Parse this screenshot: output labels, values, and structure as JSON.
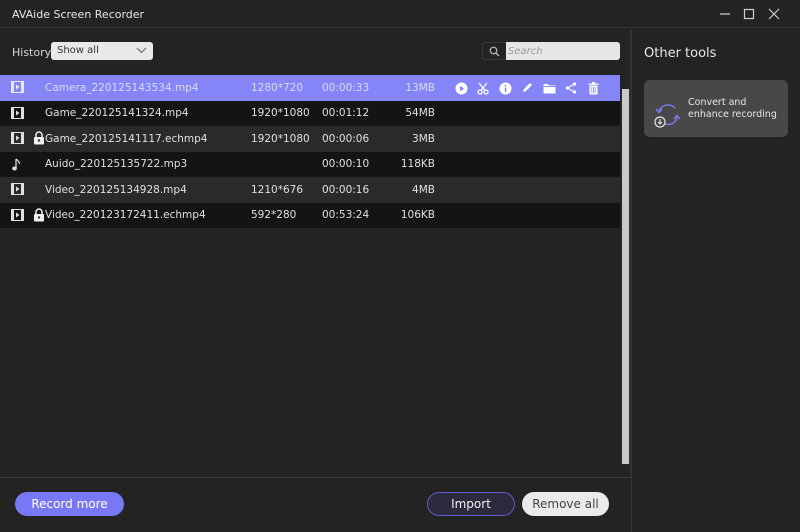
{
  "window": {
    "title": "AVAide Screen Recorder",
    "controls": [
      "minimize",
      "maximize",
      "close"
    ]
  },
  "toolbar": {
    "history_label": "History",
    "history_filter": "Show all",
    "search_placeholder": "Search"
  },
  "files": [
    {
      "icon": "video",
      "locked": false,
      "name": "Camera_220125143534.mp4",
      "resolution": "1280*720",
      "duration": "00:00:33",
      "size": "13MB",
      "selected": true
    },
    {
      "icon": "video",
      "locked": false,
      "name": "Game_220125141324.mp4",
      "resolution": "1920*1080",
      "duration": "00:01:12",
      "size": "54MB",
      "selected": false
    },
    {
      "icon": "video",
      "locked": true,
      "name": "Game_220125141117.echmp4",
      "resolution": "1920*1080",
      "duration": "00:00:06",
      "size": "3MB",
      "selected": false
    },
    {
      "icon": "audio",
      "locked": false,
      "name": "Auido_220125135722.mp3",
      "resolution": "",
      "duration": "00:00:10",
      "size": "118KB",
      "selected": false
    },
    {
      "icon": "video",
      "locked": false,
      "name": "Video_220125134928.mp4",
      "resolution": "1210*676",
      "duration": "00:00:16",
      "size": "4MB",
      "selected": false
    },
    {
      "icon": "video",
      "locked": true,
      "name": "Video_220123172411.echmp4",
      "resolution": "592*280",
      "duration": "00:53:24",
      "size": "106KB",
      "selected": false
    }
  ],
  "row_actions": [
    "play",
    "trim",
    "info",
    "rename",
    "open-folder",
    "share",
    "delete"
  ],
  "footer": {
    "record_more": "Record more",
    "import": "Import",
    "remove_all": "Remove all"
  },
  "sidebar": {
    "title": "Other tools",
    "tools": [
      {
        "label": "Convert and enhance recording",
        "icon": "convert-icon"
      }
    ]
  },
  "colors": {
    "accent": "#7878f5",
    "selected_row": "#8585f8",
    "background": "#232323"
  }
}
